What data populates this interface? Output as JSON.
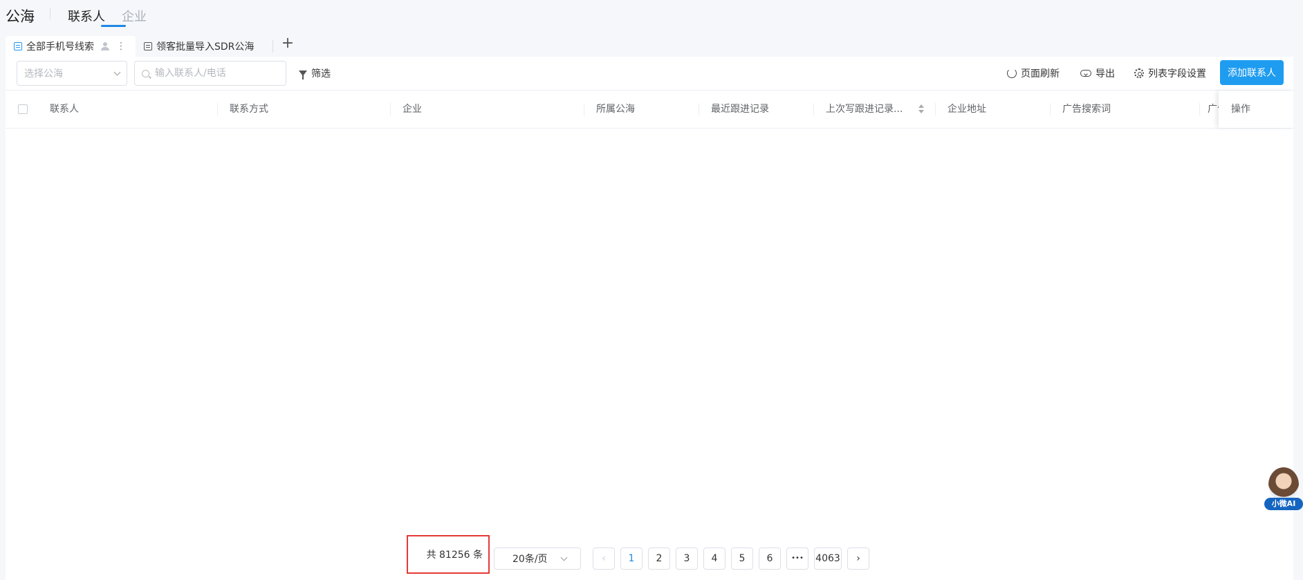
{
  "header": {
    "app_title": "公海",
    "tabs": [
      {
        "label": "联系人",
        "active": true
      },
      {
        "label": "企业",
        "active": false
      }
    ]
  },
  "view_tabs": [
    {
      "label": "全部手机号线索",
      "active": true
    },
    {
      "label": "领客批量导入SDR公海",
      "active": false
    }
  ],
  "add_tab_label": "+",
  "toolbar": {
    "sea_select_placeholder": "选择公海",
    "search_placeholder": "输入联系人/电话",
    "filter_label": "筛选",
    "refresh_label": "页面刷新",
    "export_label": "导出",
    "column_settings_label": "列表字段设置",
    "add_contact_label": "添加联系人"
  },
  "table": {
    "columns": [
      "联系人",
      "联系方式",
      "企业",
      "所属公海",
      "最近跟进记录",
      "上次写跟进记录...",
      "企业地址",
      "广告搜索词",
      "广告",
      "操作"
    ]
  },
  "pagination": {
    "total_text": "共 81256 条",
    "page_size": "20条/页",
    "pages": [
      "1",
      "2",
      "3",
      "4",
      "5",
      "6",
      "•••",
      "4063"
    ],
    "current_page": "1",
    "prev": "‹",
    "next": "›"
  },
  "ai_widget": {
    "label": "小微AI"
  },
  "colors": {
    "primary": "#1e9cf0",
    "highlight_border": "#e53935"
  }
}
